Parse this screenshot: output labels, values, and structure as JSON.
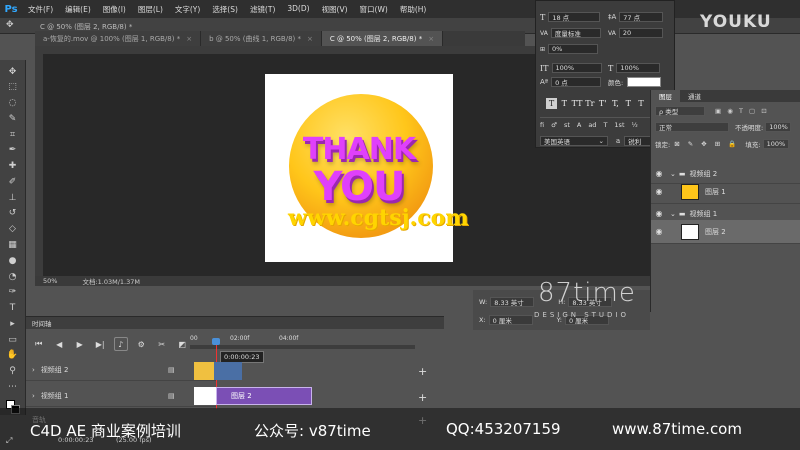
{
  "app": {
    "logo": "Ps"
  },
  "menu": [
    "文件(F)",
    "编辑(E)",
    "图像(I)",
    "图层(L)",
    "文字(Y)",
    "选择(S)",
    "滤镜(T)",
    "3D(D)",
    "视图(V)",
    "窗口(W)",
    "帮助(H)"
  ],
  "window_title": "C @ 50% (图层 2, RGB/8) *",
  "tabs": [
    {
      "label": "a-恢复的.mov @ 100% (图层 1, RGB/8) *",
      "active": false
    },
    {
      "label": "b @ 50% (曲线 1, RGB/8) *",
      "active": false
    },
    {
      "label": "C @ 50% (图层 2, RGB/8) *",
      "active": true
    }
  ],
  "canvas": {
    "artwork_text_1": "THANK",
    "artwork_text_2": "YOU",
    "overlay_url": "www.cgtsj.com"
  },
  "status": {
    "zoom": "50%",
    "doc": "文档:1.03M/1.37M"
  },
  "character": {
    "font_size": "18 点",
    "leading": "77 点",
    "tracking_label": "度量标准",
    "tracking_value": "20",
    "scale_v_pct": "0%",
    "baseline": "0 点",
    "scale_h": "100%",
    "scale_w": "100%",
    "color_label": "颜色:",
    "color": "#ffffff",
    "buttons": [
      "T",
      "T",
      "TT",
      "Tr",
      "T'",
      "T,",
      "T",
      "T"
    ],
    "language": "美国英语",
    "antialias": "锐利",
    "aa_label": "a"
  },
  "layers": {
    "tabs": [
      "图层",
      "通道"
    ],
    "filter": "ρ 类型",
    "blend": "正常",
    "opacity_label": "不透明度:",
    "opacity": "100%",
    "lock_label": "锁定:",
    "fill_label": "填充:",
    "fill": "100%",
    "items": [
      {
        "name": "视频组 2",
        "type": "group",
        "selected": false
      },
      {
        "name": "图层 1",
        "type": "layer",
        "selected": false
      },
      {
        "name": "视频组 1",
        "type": "group",
        "selected": false
      },
      {
        "name": "图层 2",
        "type": "layer",
        "selected": true
      }
    ]
  },
  "properties": {
    "w_label": "W:",
    "w": "8.33 英寸",
    "h_label": "H:",
    "h": "8.33 英寸",
    "x_label": "X:",
    "x": "0 厘米",
    "y_label": "Y:",
    "y": "0 厘米"
  },
  "timeline": {
    "title": "时间轴",
    "ruler": [
      "00",
      "02:00f",
      "04:00f"
    ],
    "current_time": "0:00:00:23",
    "tracks": [
      {
        "name": "视频组 2"
      },
      {
        "name": "视频组 1"
      }
    ],
    "clip_label": "图层 2",
    "bottom_track": "音轨",
    "timecode": "0:00:00:23",
    "fps": "(25.00 fps)"
  },
  "watermark": {
    "brand": "87time",
    "brand_sub": "DESIGN STUDIO",
    "youku": "YOUKU",
    "course": "C4D AE 商业案例培训",
    "wechat": "公众号: v87time",
    "qq": "QQ:453207159",
    "site": "www.87time.com"
  },
  "colors": {
    "accent": "#31a8ff",
    "clip_purple": "#7b4fb5",
    "clip_blue": "#4a6fa5"
  }
}
